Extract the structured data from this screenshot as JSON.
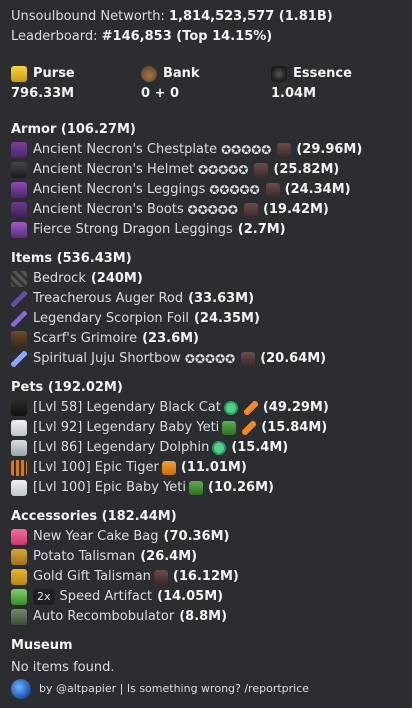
{
  "header": {
    "networth_label": "Unsoulbound Networth:",
    "networth_value": "1,814,523,577 (1.81B)",
    "leaderboard_label": "Leaderboard:",
    "leaderboard_value": "#146,853 (Top 14.15%)"
  },
  "balances": [
    {
      "label": "Purse",
      "value": "796.33M",
      "icon": "gold-ingot-icon"
    },
    {
      "label": "Bank",
      "value": "0 + 0",
      "icon": "money-bag-icon"
    },
    {
      "label": "Essence",
      "value": "1.04M",
      "icon": "wither-essence-icon"
    }
  ],
  "armor": {
    "title": "Armor (106.27M)",
    "items": [
      {
        "name": "Ancient Necron's Chestplate",
        "stars": "✪✪✪✪✪",
        "price": "(29.96M)"
      },
      {
        "name": "Ancient Necron's Helmet",
        "stars": "✪✪✪✪✪",
        "price": "(25.82M)"
      },
      {
        "name": "Ancient Necron's Leggings",
        "stars": "✪✪✪✪✪",
        "price": "(24.34M)"
      },
      {
        "name": "Ancient Necron's Boots",
        "stars": "✪✪✪✪✪",
        "price": "(19.42M)"
      },
      {
        "name": "Fierce Strong Dragon Leggings",
        "stars": "",
        "price": "(2.7M)"
      }
    ]
  },
  "items": {
    "title": "Items (536.43M)",
    "items": [
      {
        "name": "Bedrock",
        "stars": "",
        "price": "(240M)"
      },
      {
        "name": "Treacherous Auger Rod",
        "stars": "",
        "price": "(33.63M)"
      },
      {
        "name": "Legendary Scorpion Foil",
        "stars": "",
        "price": "(24.35M)"
      },
      {
        "name": "Scarf's Grimoire",
        "stars": "",
        "price": "(23.6M)"
      },
      {
        "name": "Spiritual Juju Shortbow",
        "stars": "✪✪✪✪✪",
        "price": "(20.64M)"
      }
    ]
  },
  "pets": {
    "title": "Pets (192.02M)",
    "items": [
      {
        "name": "[Lvl 58] Legendary Black Cat",
        "price": "(49.29M)"
      },
      {
        "name": "[Lvl 92] Legendary Baby Yeti",
        "price": "(15.84M)"
      },
      {
        "name": "[Lvl 86] Legendary Dolphin",
        "price": "(15.4M)"
      },
      {
        "name": "[Lvl 100] Epic Tiger",
        "price": "(11.01M)"
      },
      {
        "name": "[Lvl 100] Epic Baby Yeti",
        "price": "(10.26M)"
      }
    ]
  },
  "accessories": {
    "title": "Accessories (182.44M)",
    "items": [
      {
        "name": "New Year Cake Bag",
        "price": "(70.36M)"
      },
      {
        "name": "Potato Talisman",
        "price": "(26.4M)"
      },
      {
        "name": "Gold Gift Talisman",
        "price": "(16.12M)"
      },
      {
        "name": "Speed Artifact",
        "badge": "2x",
        "price": "(14.05M)"
      },
      {
        "name": "Auto Recombobulator",
        "price": "(8.8M)"
      }
    ]
  },
  "museum": {
    "title": "Museum",
    "text": "No items found."
  },
  "footer": {
    "text": "by @altpapier | Is something wrong? /reportprice"
  }
}
